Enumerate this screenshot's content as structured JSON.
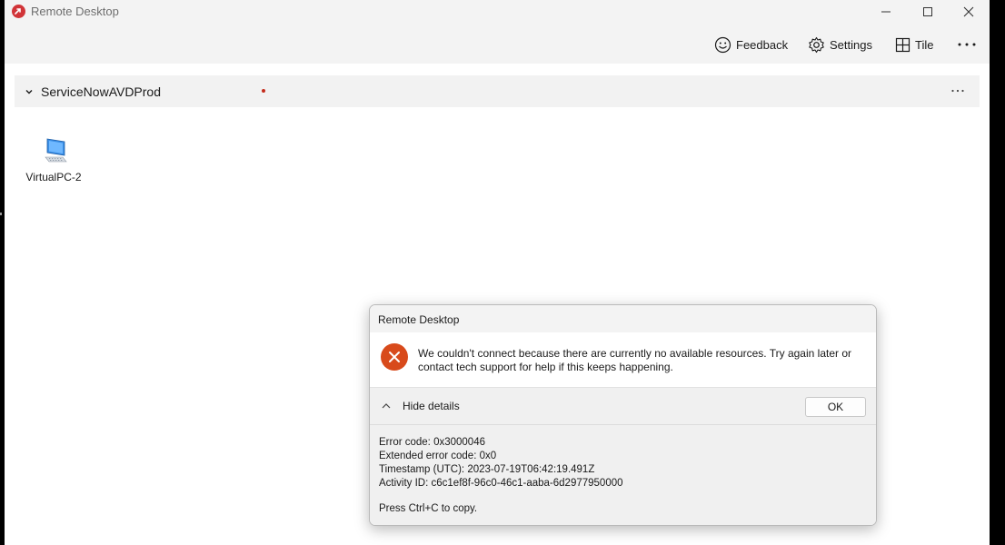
{
  "window": {
    "title": "Remote Desktop"
  },
  "toolbar": {
    "feedback_label": "Feedback",
    "settings_label": "Settings",
    "tile_label": "Tile",
    "more_icon": "more-horizontal-icon"
  },
  "workspace": {
    "name": "ServiceNowAVDProd",
    "status_dot_color": "#c42b1c",
    "resources": [
      {
        "label": "VirtualPC-2",
        "icon": "desktop-pc-icon"
      }
    ]
  },
  "dialog": {
    "title": "Remote Desktop",
    "message": "We couldn't connect because there are currently no available resources. Try again later or contact tech support for help if this keeps happening.",
    "toggle_label": "Hide details",
    "ok_label": "OK",
    "details": {
      "error_code": "Error code: 0x3000046",
      "extended_error_code": "Extended error code: 0x0",
      "timestamp": "Timestamp (UTC): 2023-07-19T06:42:19.491Z",
      "activity_id": "Activity ID: c6c1ef8f-96c0-46c1-aaba-6d2977950000"
    },
    "copy_hint": "Press Ctrl+C to copy.",
    "error_color": "#d84a1b"
  }
}
